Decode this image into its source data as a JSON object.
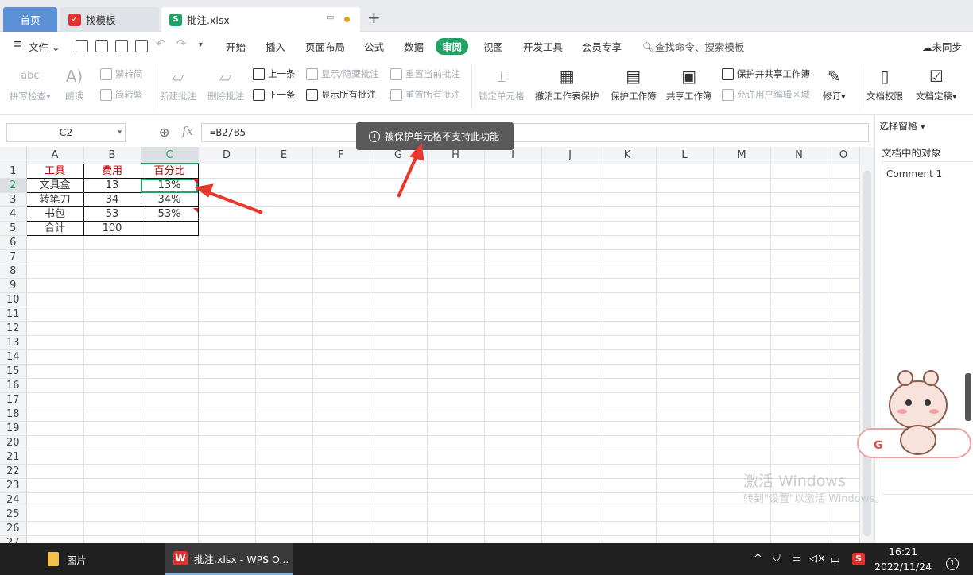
{
  "tabs": {
    "home": "首页",
    "template": "找模板",
    "file": "批注.xlsx"
  },
  "menu": {
    "file": "文件",
    "items": [
      "开始",
      "插入",
      "页面布局",
      "公式",
      "数据",
      "审阅",
      "视图",
      "开发工具",
      "会员专享"
    ],
    "active": "审阅",
    "search": "查找命令、搜索模板",
    "sync": "未同步"
  },
  "ribbon": {
    "spell": "拼写检查",
    "read": "朗读",
    "trad": "繁转简",
    "simp": "简转繁",
    "new_comment": "新建批注",
    "del_comment": "删除批注",
    "prev": "上一条",
    "next": "下一条",
    "show_hide": "显示/隐藏批注",
    "show_all": "显示所有批注",
    "reset_cur": "重置当前批注",
    "reset_all": "重置所有批注",
    "lock_cell": "锁定单元格",
    "unprotect_sheet": "撤消工作表保护",
    "protect_book": "保护工作簿",
    "share_book": "共享工作簿",
    "protect_share": "保护并共享工作簿",
    "allow_edit": "允许用户编辑区域",
    "revise": "修订",
    "doc_perm": "文档权限",
    "doc_final": "文档定稿"
  },
  "formula_bar": {
    "cell": "C2",
    "formula": "=B2/B5",
    "fx": "fx"
  },
  "toast": "被保护单元格不支持此功能",
  "columns": [
    "A",
    "B",
    "C",
    "D",
    "E",
    "F",
    "G",
    "H",
    "I",
    "J",
    "K",
    "L",
    "M",
    "N",
    "O"
  ],
  "rows": [
    "1",
    "2",
    "3",
    "4",
    "5",
    "6",
    "7",
    "8",
    "9",
    "10",
    "11",
    "12",
    "13",
    "14",
    "15",
    "16",
    "17",
    "18",
    "19",
    "20",
    "21",
    "22",
    "23",
    "24",
    "25",
    "26",
    "27"
  ],
  "table": {
    "headers": [
      "工具",
      "费用",
      "百分比"
    ],
    "data": [
      [
        "文具盒",
        "13",
        "13%"
      ],
      [
        "转笔刀",
        "34",
        "34%"
      ],
      [
        "书包",
        "53",
        "53%"
      ],
      [
        "合计",
        "100",
        ""
      ]
    ]
  },
  "pane": {
    "select": "选择窗格",
    "objects_title": "文档中的对象",
    "comment": "Comment 1"
  },
  "watermark": {
    "line1": "激活 Windows",
    "line2": "转到\"设置\"以激活 Windows。"
  },
  "taskbar": {
    "pictures": "图片",
    "wps": "批注.xlsx - WPS O...",
    "time": "16:21",
    "date": "2022/11/24",
    "ime": "中"
  },
  "colors": {
    "accent": "#21a366",
    "header_text": "#c00000",
    "home_tab": "#5b8fd6",
    "arrow": "#e8392f"
  }
}
